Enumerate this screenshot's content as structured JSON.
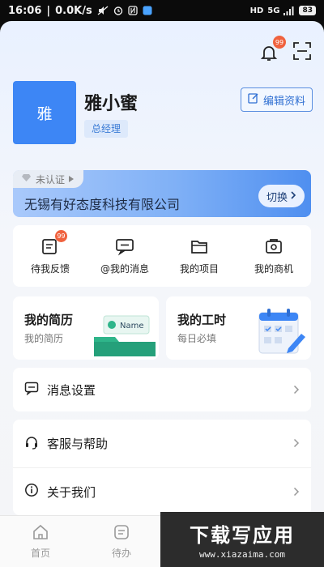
{
  "status_bar": {
    "time": "16:06",
    "network_speed": "0.0K/s",
    "signal": "5G",
    "hd": "HD",
    "battery": "83",
    "icons": [
      "mute-icon",
      "alarm-icon",
      "nfc-icon",
      "app-icon"
    ]
  },
  "header": {
    "notification_badge": "99",
    "icons": [
      "bell-icon",
      "scan-icon"
    ]
  },
  "profile": {
    "avatar_text": "雅",
    "name": "雅小蜜",
    "role": "总经理",
    "edit_label": "编辑资料"
  },
  "company": {
    "cert_status": "未认证",
    "name": "无锡有好态度科技有限公司",
    "switch_label": "切换"
  },
  "quick_actions": [
    {
      "label": "待我反馈",
      "icon": "feedback-icon",
      "badge": "99"
    },
    {
      "label": "@我的消息",
      "icon": "message-icon"
    },
    {
      "label": "我的项目",
      "icon": "project-icon"
    },
    {
      "label": "我的商机",
      "icon": "opportunity-icon"
    }
  ],
  "cards": [
    {
      "title": "我的简历",
      "subtitle": "我的简历",
      "art_text": "Name"
    },
    {
      "title": "我的工时",
      "subtitle": "每日必填"
    }
  ],
  "settings": [
    {
      "label": "消息设置",
      "icon": "message-settings-icon"
    },
    {
      "label": "客服与帮助",
      "icon": "headset-icon"
    },
    {
      "label": "关于我们",
      "icon": "info-icon"
    }
  ],
  "tabbar": [
    {
      "label": "首页",
      "icon": "home-icon"
    },
    {
      "label": "待办",
      "icon": "todo-icon"
    }
  ],
  "watermark": {
    "title": "下载写应用",
    "url": "www.xiazaima.com"
  },
  "colors": {
    "accent": "#3d86f5",
    "badge": "#f0623e",
    "page_bg": "#f4f5f7"
  }
}
